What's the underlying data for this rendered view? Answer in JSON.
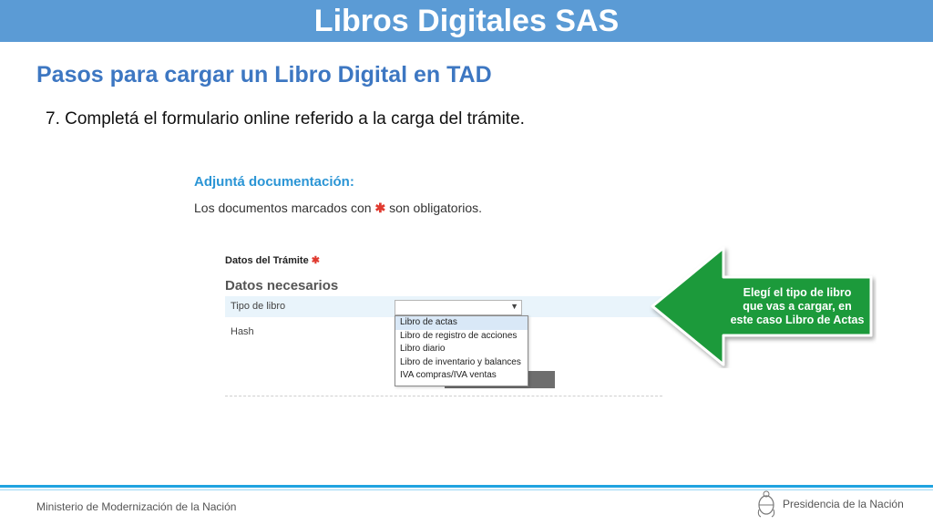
{
  "slide": {
    "title": "Libros Digitales SAS",
    "subtitle": "Pasos para cargar un Libro Digital en TAD",
    "step": "7. Completá el formulario online referido a la carga del trámite."
  },
  "form": {
    "attach_heading": "Adjuntá documentación:",
    "mandatory_prefix": "Los documentos marcados con",
    "mandatory_star": "✱",
    "mandatory_suffix": "son obligatorios.",
    "tramite_label": "Datos del Trámite",
    "tramite_star": "✱",
    "datos_heading": "Datos necesarios",
    "tipo_label": "Tipo de libro",
    "hash_label": "Hash",
    "select_value": "",
    "dropdown_options": [
      "Libro de actas",
      "Libro de registro de acciones",
      "Libro diario",
      "Libro de inventario y balances",
      "IVA compras/IVA ventas"
    ],
    "highlighted_option": "Libro de actas"
  },
  "callout": {
    "lines": [
      "Elegí el tipo de libro",
      "que vas a cargar, en",
      "este caso Libro de Actas"
    ],
    "color": "#1e9a3a"
  },
  "footer": {
    "left": "Ministerio de Modernización de la Nación",
    "right": "Presidencia de la Nación"
  },
  "colors": {
    "title_bar": "#5b9bd5",
    "subtitle": "#3d77c2",
    "form_heading": "#2b95d5",
    "required_star": "#e03a2f",
    "footer_line": "#1fa3e0"
  },
  "icons": {
    "select_caret": "chevron-down-icon",
    "footer_logo": "national-seal-icon"
  }
}
